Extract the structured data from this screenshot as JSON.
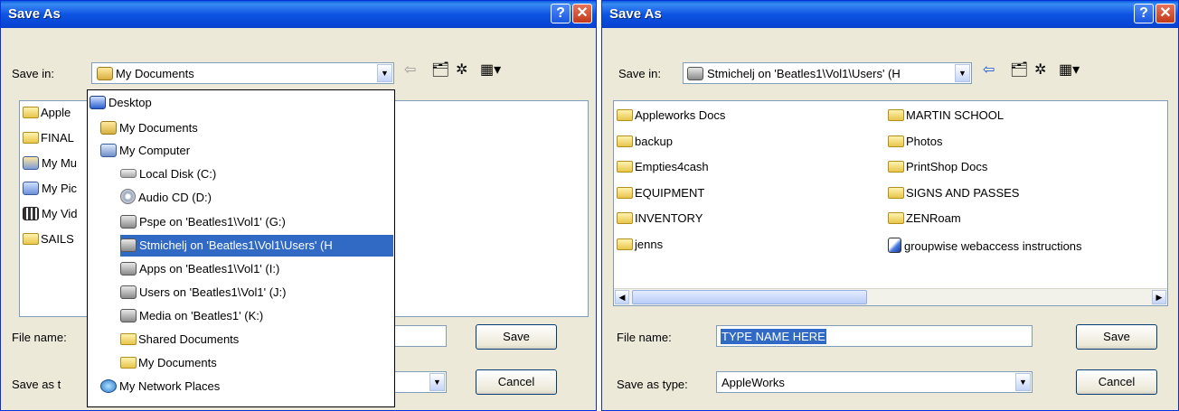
{
  "left": {
    "title": "Save As",
    "help_glyph": "?",
    "close_glyph": "✕",
    "save_in_label": "Save in:",
    "save_in_value": "My Documents",
    "file_list": [
      "Apple",
      "FINAL",
      "My Mu",
      "My Pic",
      "My Vid",
      "SAILS"
    ],
    "file_name_label": "File name:",
    "save_as_type_label": "Save as t",
    "save_button": "Save",
    "cancel_button": "Cancel",
    "dropdown": [
      {
        "label": "Desktop",
        "icon": "desktop-icon"
      },
      {
        "label": "My Documents",
        "icon": "my-documents-icon"
      },
      {
        "label": "My Computer",
        "icon": "my-computer-icon"
      },
      {
        "label": "Local Disk (C:)",
        "icon": "local-disk-icon"
      },
      {
        "label": "Audio CD (D:)",
        "icon": "audio-cd-icon"
      },
      {
        "label": "Pspe on 'Beatles1\\Vol1' (G:)",
        "icon": "network-drive-icon"
      },
      {
        "label": "Stmichelj on 'Beatles1\\Vol1\\Users' (H",
        "icon": "network-drive-icon",
        "selected": true
      },
      {
        "label": "Apps on 'Beatles1\\Vol1' (I:)",
        "icon": "network-drive-icon"
      },
      {
        "label": "Users on 'Beatles1\\Vol1' (J:)",
        "icon": "network-drive-icon"
      },
      {
        "label": "Media on 'Beatles1' (K:)",
        "icon": "network-drive-icon"
      },
      {
        "label": "Shared Documents",
        "icon": "folder-icon"
      },
      {
        "label": "My Documents",
        "icon": "folder-icon"
      },
      {
        "label": "My Network Places",
        "icon": "network-places-icon"
      }
    ]
  },
  "right": {
    "title": "Save As",
    "help_glyph": "?",
    "close_glyph": "✕",
    "save_in_label": "Save in:",
    "save_in_value": "Stmichelj on 'Beatles1\\Vol1\\Users' (H",
    "files_col1": [
      "Appleworks Docs",
      "backup",
      "Empties4cash",
      "EQUIPMENT",
      "INVENTORY",
      "jenns"
    ],
    "files_col2": [
      "MARTIN SCHOOL",
      "Photos",
      "PrintShop Docs",
      "SIGNS AND PASSES",
      "ZENRoam",
      "groupwise webaccess instructions"
    ],
    "file_name_label": "File name:",
    "file_name_value": "TYPE NAME HERE",
    "save_as_type_label": "Save as type:",
    "save_as_type_value": "AppleWorks",
    "save_button": "Save",
    "cancel_button": "Cancel"
  }
}
